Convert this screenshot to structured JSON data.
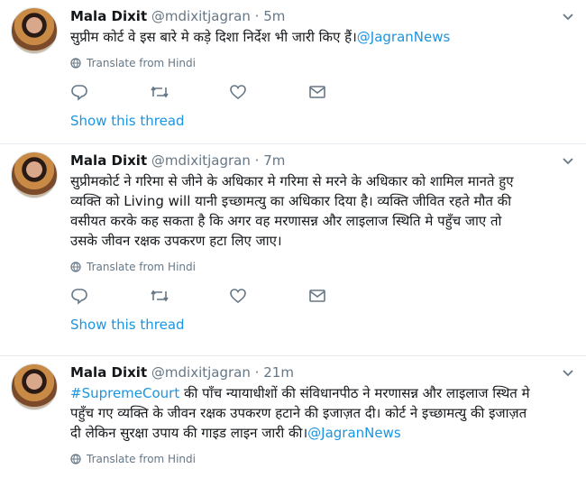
{
  "tweets": [
    {
      "name": "Mala Dixit",
      "handle": "@mdixitjagran",
      "sep": "·",
      "time": "5m",
      "text": "सुप्रीम कोर्ट वे इस बारे मे कड़े दिशा निर्देश भी जारी किए हैं।",
      "mention": "@JagranNews",
      "translate": "Translate from Hindi",
      "show_thread": "Show this thread"
    },
    {
      "name": "Mala Dixit",
      "handle": "@mdixitjagran",
      "sep": "·",
      "time": "7m",
      "lines": [
        "सुप्रीमकोर्ट ने गरिमा से जीने के अधिकार मे गरिमा से मरने के अधिकार को शामिल मानते हुए",
        "व्यक्ति को Living will यानी इच्छामत्यु का अधिकार दिया है। व्यक्ति जीवित रहते मौत की",
        "वसीयत करके कह सकता है कि अगर वह मरणासन्न और लाइलाज स्थिति मे पहुँच जाए तो",
        "उसके जीवन रक्षक उपकरण हटा लिए जाए।"
      ],
      "translate": "Translate from Hindi",
      "show_thread": "Show this thread"
    },
    {
      "name": "Mala Dixit",
      "handle": "@mdixitjagran",
      "sep": "·",
      "time": "21m",
      "hashtag": "#SupremeCourt",
      "line1_rest": " की पाँच न्यायाधीशों की संविधानपीठ ने मरणासन्न और लाइलाज स्थित मे",
      "line2": "पहुँच गए व्यक्ति के जीवन रक्षक उपकरण हटाने की इजाज़त दी। कोर्ट ने इच्छामत्यु की इजाज़त",
      "line3": "दी लेकिन सुरक्षा उपाय की गाइड लाइन जारी की।",
      "mention": "@JagranNews",
      "translate": "Translate from Hindi"
    }
  ],
  "icons": [
    "globe-icon",
    "reply-icon",
    "retweet-icon",
    "like-icon",
    "message-icon",
    "chevron-down-icon"
  ],
  "colors": {
    "link": "#1b95e0",
    "muted": "#657786",
    "text": "#14171a"
  }
}
